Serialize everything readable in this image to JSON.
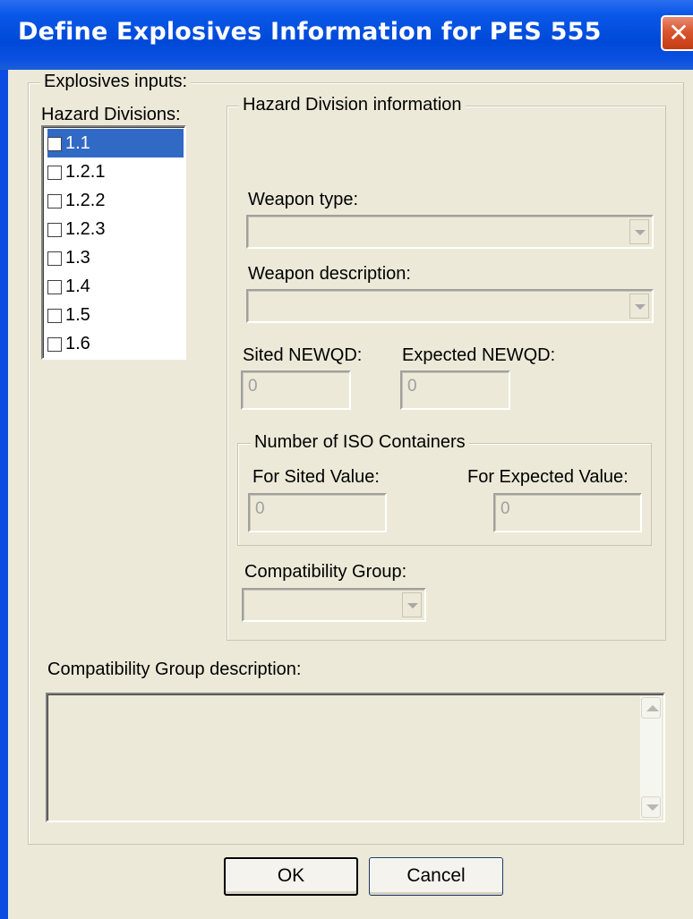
{
  "window": {
    "title": "Define Explosives Information for PES 555",
    "close_glyph": "✕"
  },
  "explosives_group": {
    "legend": "Explosives inputs:"
  },
  "hazard_divisions": {
    "label": "Hazard Divisions:",
    "items": [
      {
        "label": "1.1",
        "checked": false,
        "selected": true
      },
      {
        "label": "1.2.1",
        "checked": false,
        "selected": false
      },
      {
        "label": "1.2.2",
        "checked": false,
        "selected": false
      },
      {
        "label": "1.2.3",
        "checked": false,
        "selected": false
      },
      {
        "label": "1.3",
        "checked": false,
        "selected": false
      },
      {
        "label": "1.4",
        "checked": false,
        "selected": false
      },
      {
        "label": "1.5",
        "checked": false,
        "selected": false
      },
      {
        "label": "1.6",
        "checked": false,
        "selected": false
      }
    ]
  },
  "hd_info": {
    "legend": "Hazard Division information",
    "weapon_type_label": "Weapon type:",
    "weapon_type_value": "",
    "weapon_desc_label": "Weapon description:",
    "weapon_desc_value": "",
    "sited_newqd_label": "Sited NEWQD:",
    "sited_newqd_value": "0",
    "expected_newqd_label": "Expected NEWQD:",
    "expected_newqd_value": "0",
    "iso": {
      "legend": "Number of ISO Containers",
      "sited_label": "For Sited Value:",
      "sited_value": "0",
      "expected_label": "For Expected Value:",
      "expected_value": "0"
    },
    "compat_group_label": "Compatibility Group:",
    "compat_group_value": ""
  },
  "compat_desc": {
    "label": "Compatibility Group description:",
    "value": ""
  },
  "buttons": {
    "ok": "OK",
    "cancel": "Cancel"
  },
  "colors": {
    "titlebar": "#0049d8",
    "selection": "#316ac5",
    "dialog_bg": "#ece9d8"
  }
}
